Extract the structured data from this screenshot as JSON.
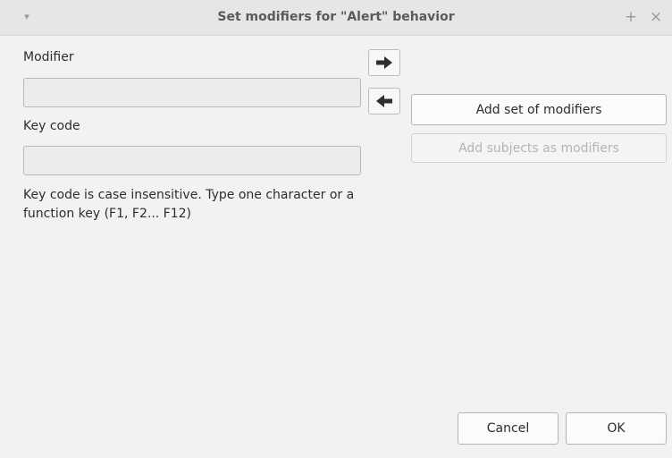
{
  "window": {
    "title": "Set modifiers for \"Alert\" behavior",
    "menu_icon": "▾",
    "pin_icon": "+",
    "close_icon": "×"
  },
  "form": {
    "modifier_label": "Modifier",
    "modifier_value": "",
    "keycode_label": "Key code",
    "keycode_value": "",
    "hint": "Key code is case insensitive. Type one character or a function key (F1, F2... F12)"
  },
  "actions": {
    "add_set_label": "Add set of modifiers",
    "add_subjects_label": "Add subjects as modifiers",
    "cancel_label": "Cancel",
    "ok_label": "OK"
  },
  "icons": {
    "right": "arrow-right-icon",
    "left": "arrow-left-icon"
  }
}
